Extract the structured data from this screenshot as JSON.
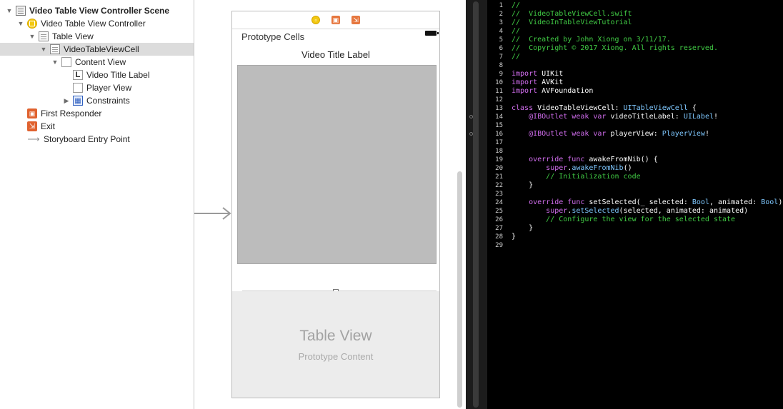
{
  "outline": {
    "items": [
      {
        "label": "Video Table View Controller Scene",
        "icon": "scene-icon",
        "indent": 0,
        "disclosure": "open",
        "selected": false,
        "bold": true
      },
      {
        "label": "Video Table View Controller",
        "icon": "view-controller-icon",
        "indent": 1,
        "disclosure": "open",
        "selected": false
      },
      {
        "label": "Table View",
        "icon": "table-view-icon",
        "indent": 2,
        "disclosure": "open",
        "selected": false
      },
      {
        "label": "VideoTableViewCell",
        "icon": "table-cell-icon",
        "indent": 3,
        "disclosure": "open",
        "selected": true
      },
      {
        "label": "Content View",
        "icon": "view-icon",
        "indent": 4,
        "disclosure": "open",
        "selected": false
      },
      {
        "label": "Video Title Label",
        "icon": "label-icon",
        "indent": 5,
        "disclosure": "none",
        "selected": false
      },
      {
        "label": "Player View",
        "icon": "view-icon",
        "indent": 5,
        "disclosure": "none",
        "selected": false
      },
      {
        "label": "Constraints",
        "icon": "constraints-icon",
        "indent": 5,
        "disclosure": "closed",
        "selected": false
      },
      {
        "label": "First Responder",
        "icon": "first-responder-icon",
        "indent": 1,
        "disclosure": "none",
        "selected": false
      },
      {
        "label": "Exit",
        "icon": "exit-icon",
        "indent": 1,
        "disclosure": "none",
        "selected": false
      },
      {
        "label": "Storyboard Entry Point",
        "icon": "entry-arrow-icon",
        "indent": 1,
        "disclosure": "none",
        "selected": false
      }
    ]
  },
  "canvas": {
    "prototype_header": "Prototype Cells",
    "cell_title_label": "Video Title Label",
    "table_view_title": "Table View",
    "table_view_subtitle": "Prototype Content",
    "dock_icons": [
      "view-controller-icon",
      "first-responder-icon",
      "exit-icon"
    ]
  },
  "editor": {
    "colors": {
      "background": "#000000",
      "comment": "#41cc45",
      "keyword": "#d36ef0",
      "type": "#7fc8ff",
      "plain": "#ffffff"
    },
    "lines": [
      {
        "n": "1",
        "bp": false,
        "tokens": [
          {
            "t": "//",
            "c": "comment"
          }
        ]
      },
      {
        "n": "2",
        "bp": false,
        "tokens": [
          {
            "t": "//  VideoTableViewCell.swift",
            "c": "comment"
          }
        ]
      },
      {
        "n": "3",
        "bp": false,
        "tokens": [
          {
            "t": "//  VideoInTableViewTutorial",
            "c": "comment"
          }
        ]
      },
      {
        "n": "4",
        "bp": false,
        "tokens": [
          {
            "t": "//",
            "c": "comment"
          }
        ]
      },
      {
        "n": "5",
        "bp": false,
        "tokens": [
          {
            "t": "//  Created by John Xiong on 3/11/17.",
            "c": "comment"
          }
        ]
      },
      {
        "n": "6",
        "bp": false,
        "tokens": [
          {
            "t": "//  Copyright © 2017 Xiong. All rights reserved.",
            "c": "comment"
          }
        ]
      },
      {
        "n": "7",
        "bp": false,
        "tokens": [
          {
            "t": "//",
            "c": "comment"
          }
        ]
      },
      {
        "n": "8",
        "bp": false,
        "tokens": []
      },
      {
        "n": "9",
        "bp": false,
        "tokens": [
          {
            "t": "import",
            "c": "kw"
          },
          {
            "t": " UIKit",
            "c": "plain"
          }
        ]
      },
      {
        "n": "10",
        "bp": false,
        "tokens": [
          {
            "t": "import",
            "c": "kw"
          },
          {
            "t": " AVKit",
            "c": "plain"
          }
        ]
      },
      {
        "n": "11",
        "bp": false,
        "tokens": [
          {
            "t": "import",
            "c": "kw"
          },
          {
            "t": " AVFoundation",
            "c": "plain"
          }
        ]
      },
      {
        "n": "12",
        "bp": false,
        "tokens": []
      },
      {
        "n": "13",
        "bp": false,
        "tokens": [
          {
            "t": "class",
            "c": "kw"
          },
          {
            "t": " VideoTableViewCell: ",
            "c": "plain"
          },
          {
            "t": "UITableViewCell",
            "c": "type"
          },
          {
            "t": " {",
            "c": "plain"
          }
        ]
      },
      {
        "n": "14",
        "bp": true,
        "tokens": [
          {
            "t": "    ",
            "c": "plain"
          },
          {
            "t": "@IBOutlet weak var",
            "c": "kw"
          },
          {
            "t": " videoTitleLabel: ",
            "c": "plain"
          },
          {
            "t": "UILabel",
            "c": "type"
          },
          {
            "t": "!",
            "c": "plain"
          }
        ]
      },
      {
        "n": "15",
        "bp": false,
        "tokens": []
      },
      {
        "n": "16",
        "bp": true,
        "tokens": [
          {
            "t": "    ",
            "c": "plain"
          },
          {
            "t": "@IBOutlet weak var",
            "c": "kw"
          },
          {
            "t": " playerView: ",
            "c": "plain"
          },
          {
            "t": "PlayerView",
            "c": "type"
          },
          {
            "t": "!",
            "c": "plain"
          }
        ]
      },
      {
        "n": "17",
        "bp": false,
        "tokens": []
      },
      {
        "n": "18",
        "bp": false,
        "tokens": []
      },
      {
        "n": "19",
        "bp": false,
        "tokens": [
          {
            "t": "    ",
            "c": "plain"
          },
          {
            "t": "override func",
            "c": "kw"
          },
          {
            "t": " awakeFromNib() {",
            "c": "plain"
          }
        ]
      },
      {
        "n": "20",
        "bp": false,
        "tokens": [
          {
            "t": "        ",
            "c": "plain"
          },
          {
            "t": "super",
            "c": "kw"
          },
          {
            "t": ".",
            "c": "plain"
          },
          {
            "t": "awakeFromNib",
            "c": "type"
          },
          {
            "t": "()",
            "c": "plain"
          }
        ]
      },
      {
        "n": "21",
        "bp": false,
        "tokens": [
          {
            "t": "        ",
            "c": "plain"
          },
          {
            "t": "// Initialization code",
            "c": "comment"
          }
        ]
      },
      {
        "n": "22",
        "bp": false,
        "tokens": [
          {
            "t": "    }",
            "c": "plain"
          }
        ]
      },
      {
        "n": "23",
        "bp": false,
        "tokens": []
      },
      {
        "n": "24",
        "bp": false,
        "tokens": [
          {
            "t": "    ",
            "c": "plain"
          },
          {
            "t": "override func",
            "c": "kw"
          },
          {
            "t": " setSelected(_ selected: ",
            "c": "plain"
          },
          {
            "t": "Bool",
            "c": "type"
          },
          {
            "t": ", animated: ",
            "c": "plain"
          },
          {
            "t": "Bool",
            "c": "type"
          },
          {
            "t": ") {",
            "c": "plain"
          }
        ]
      },
      {
        "n": "25",
        "bp": false,
        "tokens": [
          {
            "t": "        ",
            "c": "plain"
          },
          {
            "t": "super",
            "c": "kw"
          },
          {
            "t": ".",
            "c": "plain"
          },
          {
            "t": "setSelected",
            "c": "type"
          },
          {
            "t": "(selected, animated: animated)",
            "c": "plain"
          }
        ]
      },
      {
        "n": "26",
        "bp": false,
        "tokens": [
          {
            "t": "        ",
            "c": "plain"
          },
          {
            "t": "// Configure the view for the selected state",
            "c": "comment"
          }
        ]
      },
      {
        "n": "27",
        "bp": false,
        "tokens": [
          {
            "t": "    }",
            "c": "plain"
          }
        ]
      },
      {
        "n": "28",
        "bp": false,
        "tokens": [
          {
            "t": "}",
            "c": "plain"
          }
        ]
      },
      {
        "n": "29",
        "bp": false,
        "tokens": []
      }
    ]
  }
}
